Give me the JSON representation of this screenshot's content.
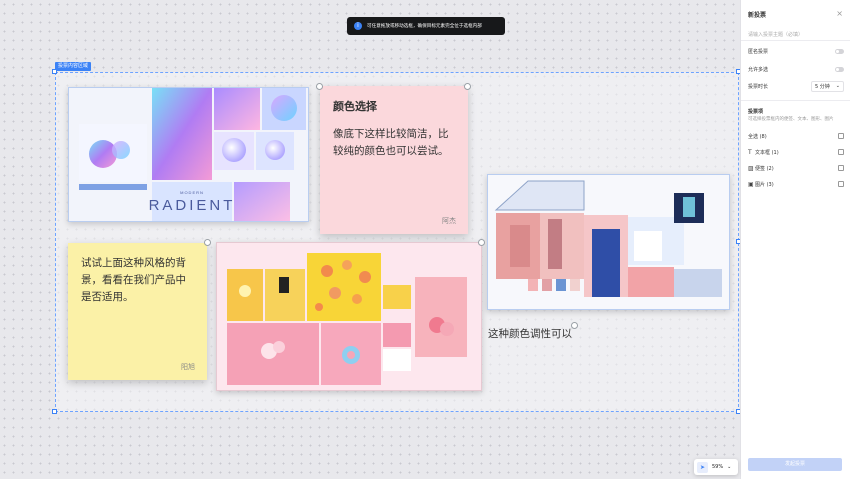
{
  "toast": {
    "icon": "info-icon",
    "text": "可任意拖放或移动选框，确保目标元素完全位于选框内部"
  },
  "frame": {
    "tag": "投票内容区域"
  },
  "notes": [
    {
      "title": "颜色选择",
      "body": "像底下这样比较简洁，比较纯的颜色也可以尝试。",
      "author": "阿杰",
      "color": "#fbd8dc"
    },
    {
      "body": "试试上面这种风格的背景，看看在我们产品中是否适用。",
      "author": "阳旭",
      "color": "#fbf1a7"
    }
  ],
  "canvas_text": "这种颜色调性可以",
  "images": {
    "gradient_poster_word": "RADIENT",
    "gradient_poster_small": "MODERN"
  },
  "panel": {
    "title": "新投票",
    "close_icon": "close-icon",
    "title_placeholder": "请输入投票主题（必填）",
    "anonymous": {
      "label": "匿名投票",
      "on": false
    },
    "multiple": {
      "label": "允许多选",
      "on": false
    },
    "duration": {
      "label": "投票时长",
      "value": "5 分钟"
    },
    "section_title": "投票项",
    "section_hint": "可选择投票框内的便签、文本、图形、图片",
    "options": [
      {
        "label": "全选 (8)",
        "icon": ""
      },
      {
        "label": "文本框 (1)",
        "icon": "text-icon"
      },
      {
        "label": "便签 (2)",
        "icon": "sticky-note-icon"
      },
      {
        "label": "图片 (3)",
        "icon": "image-icon"
      }
    ],
    "submit": "发起投票"
  },
  "zoom": {
    "value": "59%",
    "tool_icon": "cursor-icon"
  }
}
